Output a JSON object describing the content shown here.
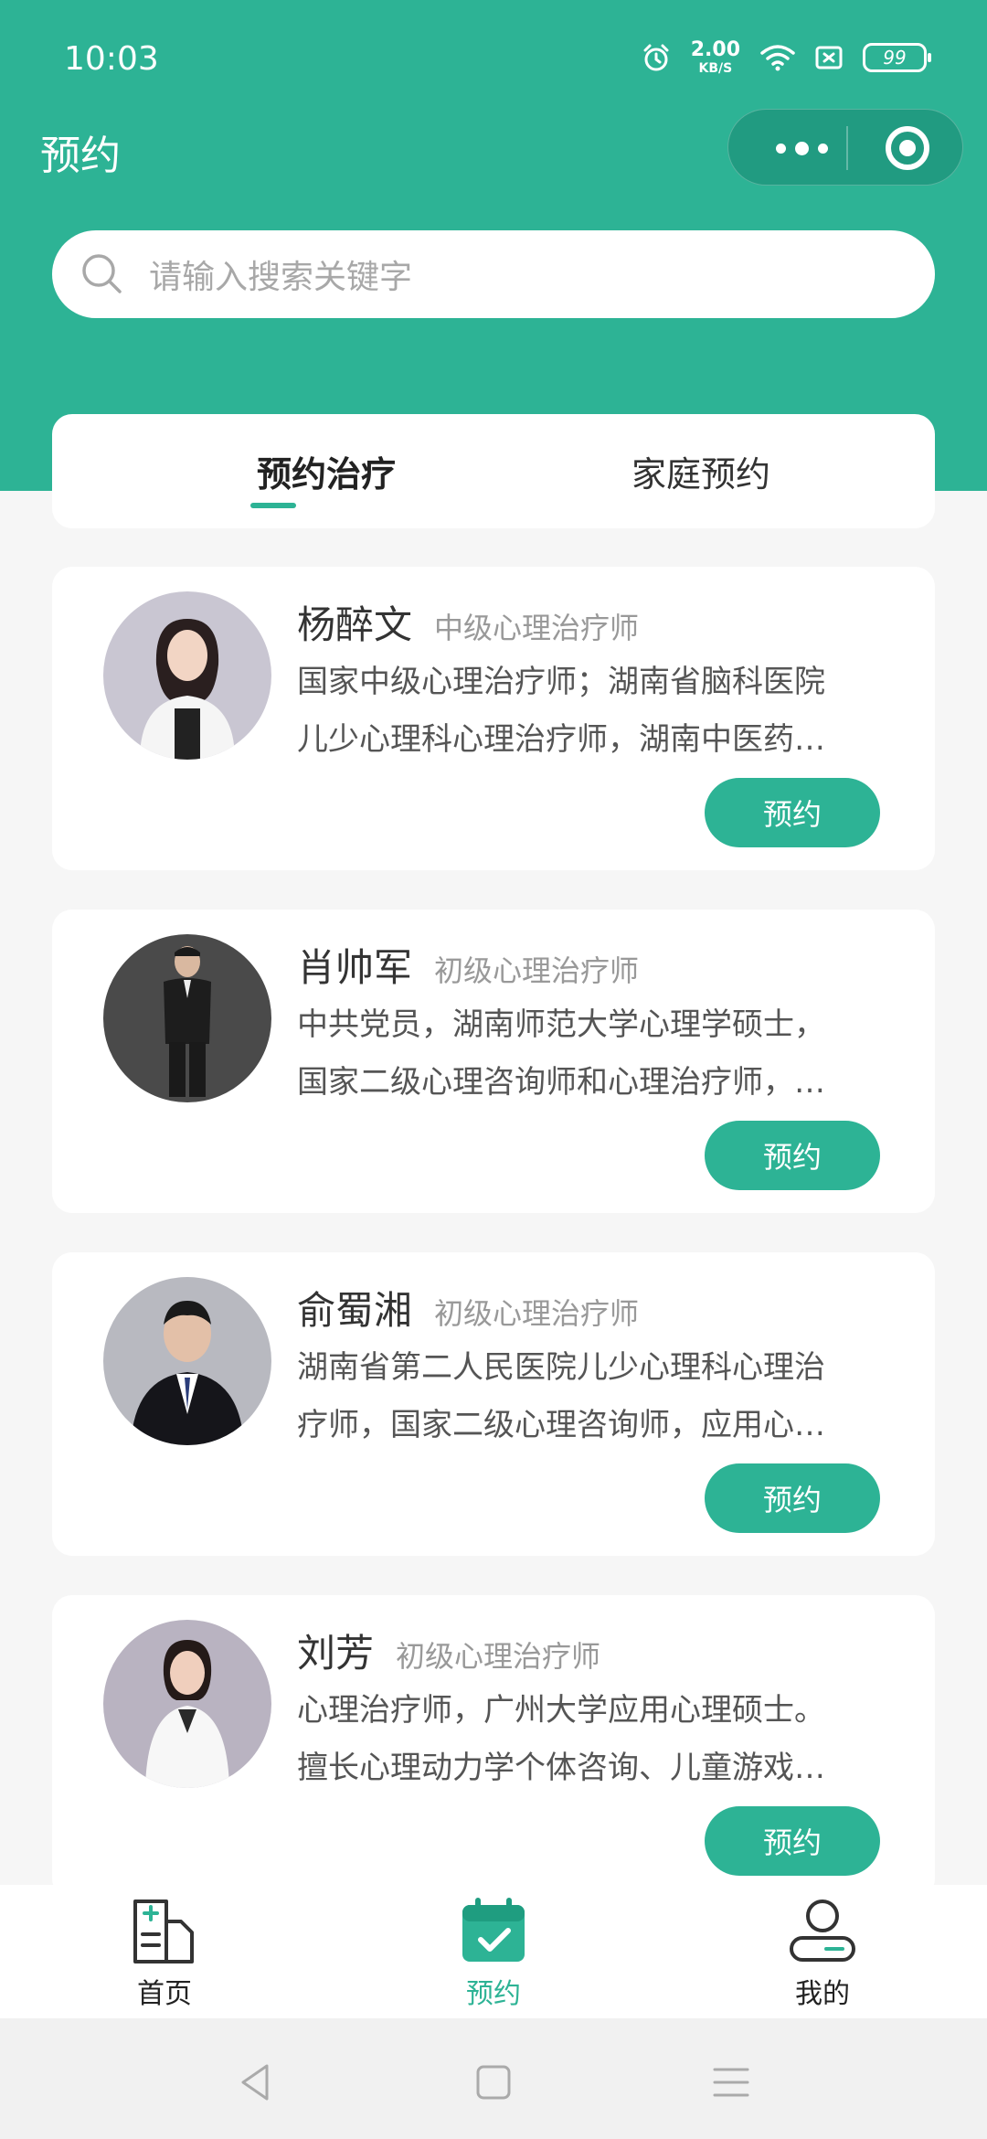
{
  "status_bar": {
    "time": "10:03",
    "net_speed": "2.00",
    "net_unit": "KB/S",
    "battery": "99"
  },
  "nav": {
    "title": "预约"
  },
  "search": {
    "placeholder": "请输入搜索关键字"
  },
  "tabs": [
    {
      "label": "预约治疗",
      "active": true
    },
    {
      "label": "家庭预约",
      "active": false
    }
  ],
  "doctors": [
    {
      "name": "杨醉文",
      "level": "中级心理治疗师",
      "desc_line1": "国家中级心理治疗师；湖南省脑科医院",
      "desc_line2": "儿少心理科心理治疗师，湖南中医药…",
      "button": "预约"
    },
    {
      "name": "肖帅军",
      "level": "初级心理治疗师",
      "desc_line1": "中共党员，湖南师范大学心理学硕士，",
      "desc_line2": "国家二级心理咨询师和心理治疗师，…",
      "button": "预约"
    },
    {
      "name": "俞蜀湘",
      "level": "初级心理治疗师",
      "desc_line1": "湖南省第二人民医院儿少心理科心理治",
      "desc_line2": "疗师，国家二级心理咨询师，应用心…",
      "button": "预约"
    },
    {
      "name": "刘芳",
      "level": "初级心理治疗师",
      "desc_line1": "心理治疗师，广州大学应用心理硕士。",
      "desc_line2": "擅长心理动力学个体咨询、儿童游戏…",
      "button": "预约"
    }
  ],
  "tabbar": [
    {
      "label": "首页",
      "icon": "home-document-icon",
      "active": false
    },
    {
      "label": "预约",
      "icon": "calendar-check-icon",
      "active": true
    },
    {
      "label": "我的",
      "icon": "user-icon",
      "active": false
    }
  ],
  "colors": {
    "primary": "#2db395",
    "active_tab_label": "#2db395",
    "inactive_tab_label": "#222222"
  }
}
